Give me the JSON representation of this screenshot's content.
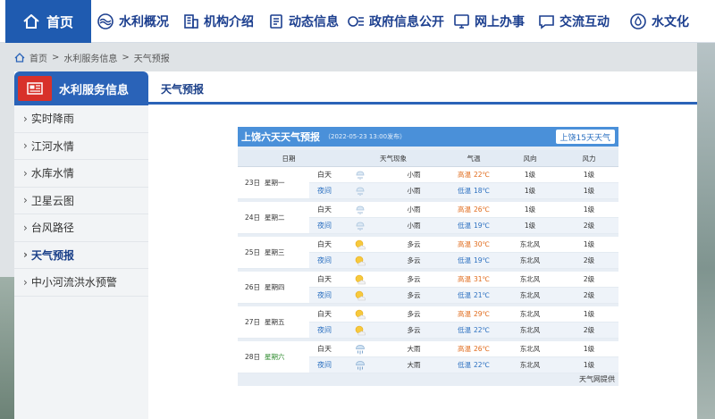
{
  "nav": {
    "home": "首页",
    "items": [
      "水利概况",
      "机构介绍",
      "动态信息",
      "政府信息公开",
      "网上办事",
      "交流互动",
      "水文化"
    ]
  },
  "breadcrumb": [
    "首页",
    "水利服务信息",
    "天气预报"
  ],
  "sidebar": {
    "title": "水利服务信息",
    "items": [
      "实时降雨",
      "江河水情",
      "水库水情",
      "卫星云图",
      "台风路径",
      "天气预报",
      "中小河流洪水预警"
    ],
    "active_index": 5
  },
  "tab_title": "天气预报",
  "weather": {
    "title": "上饶六天天气预报",
    "published": "（2022-05-23 13:00发布）",
    "link_15": "上饶15天天气",
    "headers": {
      "date": "日期",
      "phenomenon": "天气现象",
      "temp": "气温",
      "wind_dir": "风向",
      "wind_level": "风力"
    },
    "hi_label": "高温",
    "lo_label": "低温",
    "day_label": "白天",
    "night_label": "夜间",
    "days": [
      {
        "date": "23日",
        "week": "星期一",
        "day": {
          "icon": "rain-icon",
          "text": "小雨",
          "temp": "22℃",
          "dir": "1级",
          "level": "1级"
        },
        "night": {
          "icon": "rain-icon",
          "text": "小雨",
          "temp": "18℃",
          "dir": "1级",
          "level": "1级"
        }
      },
      {
        "date": "24日",
        "week": "星期二",
        "day": {
          "icon": "rain-icon",
          "text": "小雨",
          "temp": "26℃",
          "dir": "1级",
          "level": "1级"
        },
        "night": {
          "icon": "rain-icon",
          "text": "小雨",
          "temp": "19℃",
          "dir": "1级",
          "level": "2级"
        }
      },
      {
        "date": "25日",
        "week": "星期三",
        "day": {
          "icon": "cloudy-icon",
          "text": "多云",
          "temp": "30℃",
          "dir": "东北风",
          "level": "1级"
        },
        "night": {
          "icon": "cloudy-icon",
          "text": "多云",
          "temp": "19℃",
          "dir": "东北风",
          "level": "2级"
        }
      },
      {
        "date": "26日",
        "week": "星期四",
        "day": {
          "icon": "cloudy-icon",
          "text": "多云",
          "temp": "31℃",
          "dir": "东北风",
          "level": "2级"
        },
        "night": {
          "icon": "cloudy-icon",
          "text": "多云",
          "temp": "21℃",
          "dir": "东北风",
          "level": "2级"
        }
      },
      {
        "date": "27日",
        "week": "星期五",
        "day": {
          "icon": "cloudy-icon",
          "text": "多云",
          "temp": "29℃",
          "dir": "东北风",
          "level": "1级"
        },
        "night": {
          "icon": "cloudy-icon",
          "text": "多云",
          "temp": "22℃",
          "dir": "东北风",
          "level": "2级"
        }
      },
      {
        "date": "28日",
        "week": "星期六",
        "day": {
          "icon": "heavy-rain-icon",
          "text": "大雨",
          "temp": "26℃",
          "dir": "东北风",
          "level": "1级"
        },
        "night": {
          "icon": "heavy-rain-icon",
          "text": "大雨",
          "temp": "22℃",
          "dir": "东北风",
          "level": "1级"
        }
      }
    ],
    "footer": "天气网提供"
  },
  "colors": {
    "brand": "#1f5bb0",
    "nav_text": "#1c3f8f",
    "accent_red": "#d8312a",
    "high": "#e06a1a",
    "low": "#2a6fc0",
    "widget_head": "#4a90d9"
  }
}
